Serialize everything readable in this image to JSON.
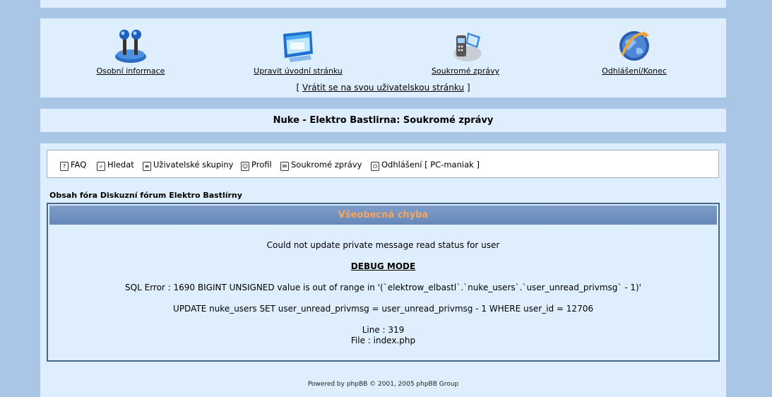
{
  "nav": {
    "items": [
      {
        "label": "Osobní informace",
        "icon": "joystick-icon"
      },
      {
        "label": "Upravit úvodní stránku",
        "icon": "monitor-window-icon"
      },
      {
        "label": "Soukromé zprávy",
        "icon": "phone-message-icon"
      },
      {
        "label": "Odhlášení/Konec",
        "icon": "globe-exit-icon"
      }
    ],
    "return_prefix": "[",
    "return_link": "Vrátit se na svou uživatelskou stránku",
    "return_suffix": "]"
  },
  "page_title": "Nuke - Elektro Bastlirna: Soukromé zprávy",
  "toolbar": {
    "faq": "FAQ",
    "search": "Hledat",
    "groups": "Uživatelské skupiny",
    "profile": "Profil",
    "pm": "Soukromé zprávy",
    "logout": "Odhlášení [ PC-maniak ]"
  },
  "breadcrumb": "Obsah fóra Diskuzní fórum Elektro Bastlírny",
  "error": {
    "title": "Všeobecná chyba",
    "message": "Could not update private message read status for user",
    "debug": "DEBUG MODE",
    "sql_error": "SQL Error : 1690 BIGINT UNSIGNED value is out of range in '(`elektrow_elbastl`.`nuke_users`.`user_unread_privmsg` - 1)'",
    "query": "UPDATE nuke_users SET user_unread_privmsg = user_unread_privmsg - 1 WHERE user_id = 12706",
    "line": "Line : 319",
    "file": "File : index.php"
  },
  "footer": "Powered by phpBB © 2001, 2005 phpBB Group",
  "colors": {
    "background": "#a9c6e6",
    "panel": "#deeefc",
    "header_title": "#f8a55a",
    "border": "#43688c"
  }
}
